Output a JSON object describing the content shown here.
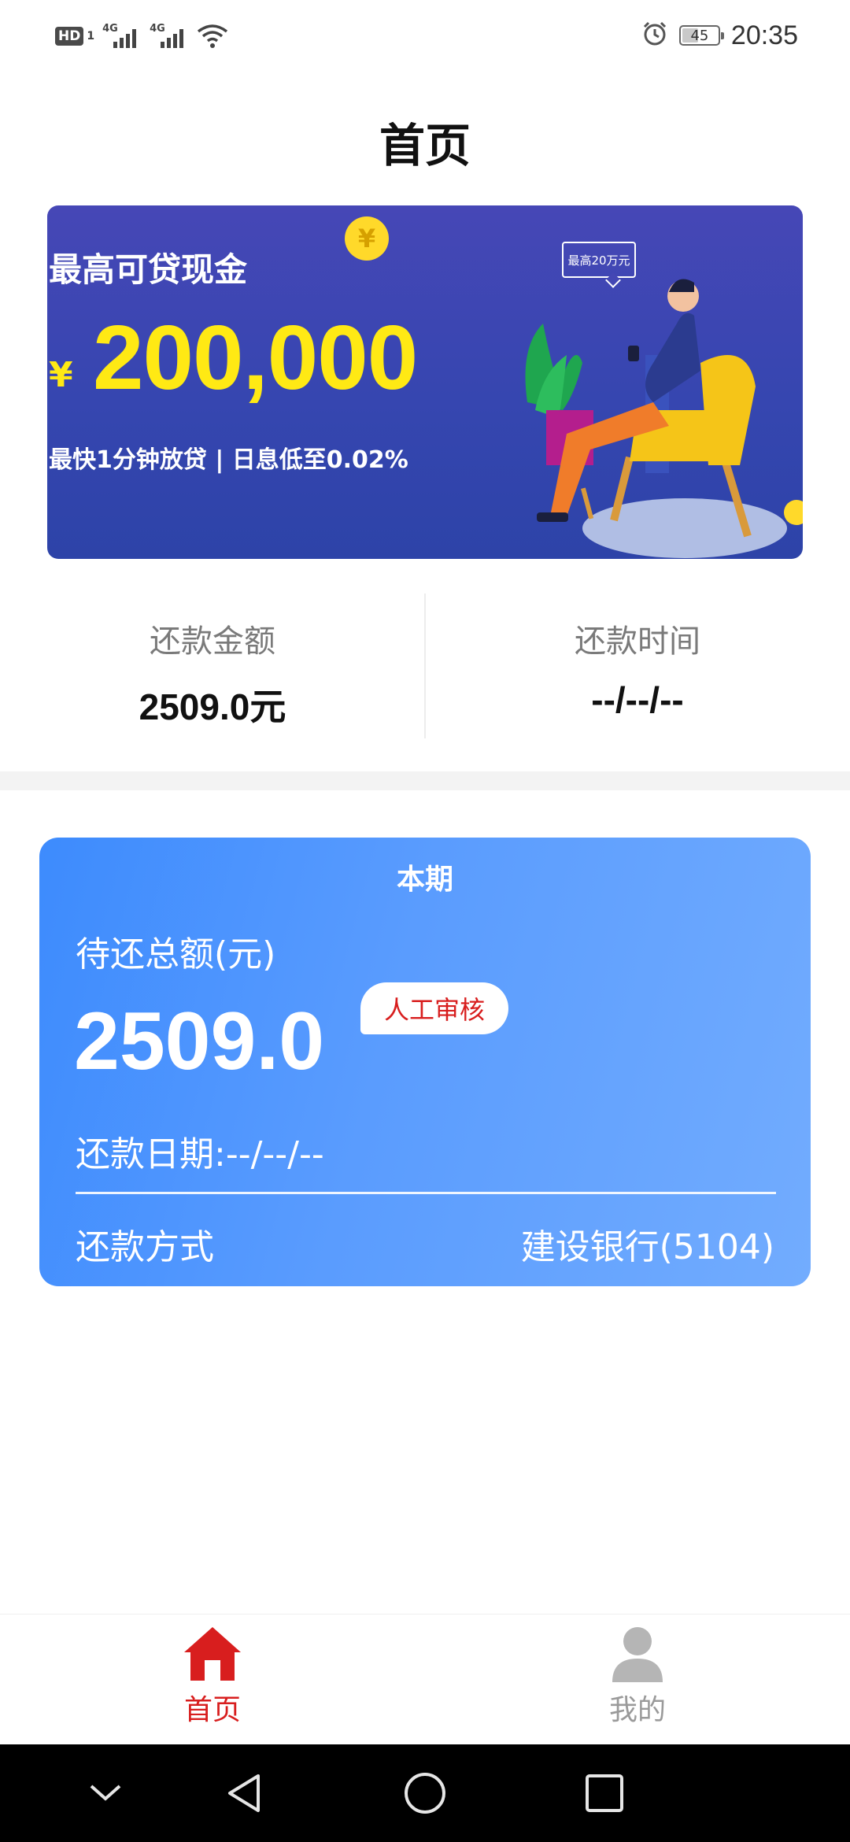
{
  "status_bar": {
    "hd_badge": "HD",
    "sim_number": "1",
    "network_1": "4G",
    "network_2": "4G",
    "battery_level": 45,
    "battery_text": "45",
    "time": "20:35",
    "icons": [
      "hd-icon",
      "signal-icon",
      "signal-icon",
      "wifi-icon",
      "alarm-icon",
      "battery-icon"
    ]
  },
  "page_title": "首页",
  "banner": {
    "headline": "最高可贷现金",
    "currency_symbol": "¥",
    "amount": "200,000",
    "subline": "最快1分钟放贷 | 日息低至0.02%",
    "coin_symbol": "¥",
    "bubble_text": "最高20万元",
    "colors": {
      "background": "#3a46b0",
      "accent": "#ffe914"
    }
  },
  "summary": {
    "amount_label": "还款金额",
    "amount_value": "2509.0元",
    "time_label": "还款时间",
    "time_value": "--/--/--"
  },
  "bill_card": {
    "title": "本期",
    "total_label": "待还总额(元)",
    "total_amount": "2509.0",
    "status_badge": "人工审核",
    "due_date": "还款日期:--/--/--",
    "method_label": "还款方式",
    "method_value": "建设银行(5104)",
    "colors": {
      "gradient_start": "#3d8bfd",
      "gradient_end": "#72acfe",
      "badge_text": "#d81e1e"
    }
  },
  "tab_bar": {
    "tabs": [
      {
        "label": "首页",
        "icon": "home-icon",
        "active": true
      },
      {
        "label": "我的",
        "icon": "user-icon",
        "active": false
      }
    ],
    "colors": {
      "active": "#d81e1e",
      "inactive": "#9a9a9a"
    }
  },
  "nav_bar": {
    "buttons": [
      "chevron-down-icon",
      "back-icon",
      "home-circle-icon",
      "recents-icon"
    ]
  }
}
